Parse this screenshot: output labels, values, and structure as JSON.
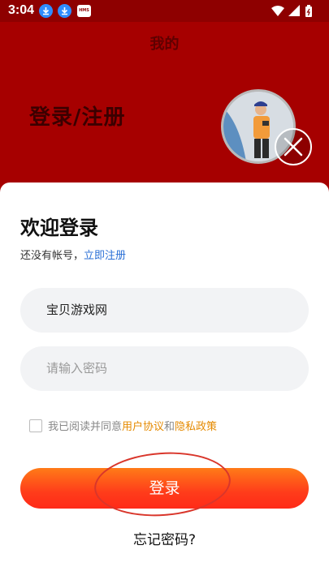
{
  "status_bar": {
    "time": "3:04",
    "icons": [
      "download-icon",
      "download-icon",
      "hms-icon",
      "wifi-icon",
      "signal-icon",
      "battery-icon"
    ],
    "hms_label": "HMS"
  },
  "header": {
    "title": "我的",
    "login_register": "登录/注册"
  },
  "form": {
    "welcome_title": "欢迎登录",
    "no_account_text": "还没有帐号，",
    "register_link": "立即注册",
    "username_value": "宝贝游戏网",
    "password_placeholder": "请输入密码",
    "agree_prefix": "我已阅读并同意",
    "user_agreement": "用户协议",
    "and": "和",
    "privacy_policy": "隐私政策",
    "login_button": "登录",
    "forgot_password": "忘记密码?"
  },
  "colors": {
    "header_bg": "#a60000",
    "accent_orange": "#ff5a1a",
    "link_blue": "#2a6fd6",
    "link_orange": "#e58a00"
  }
}
